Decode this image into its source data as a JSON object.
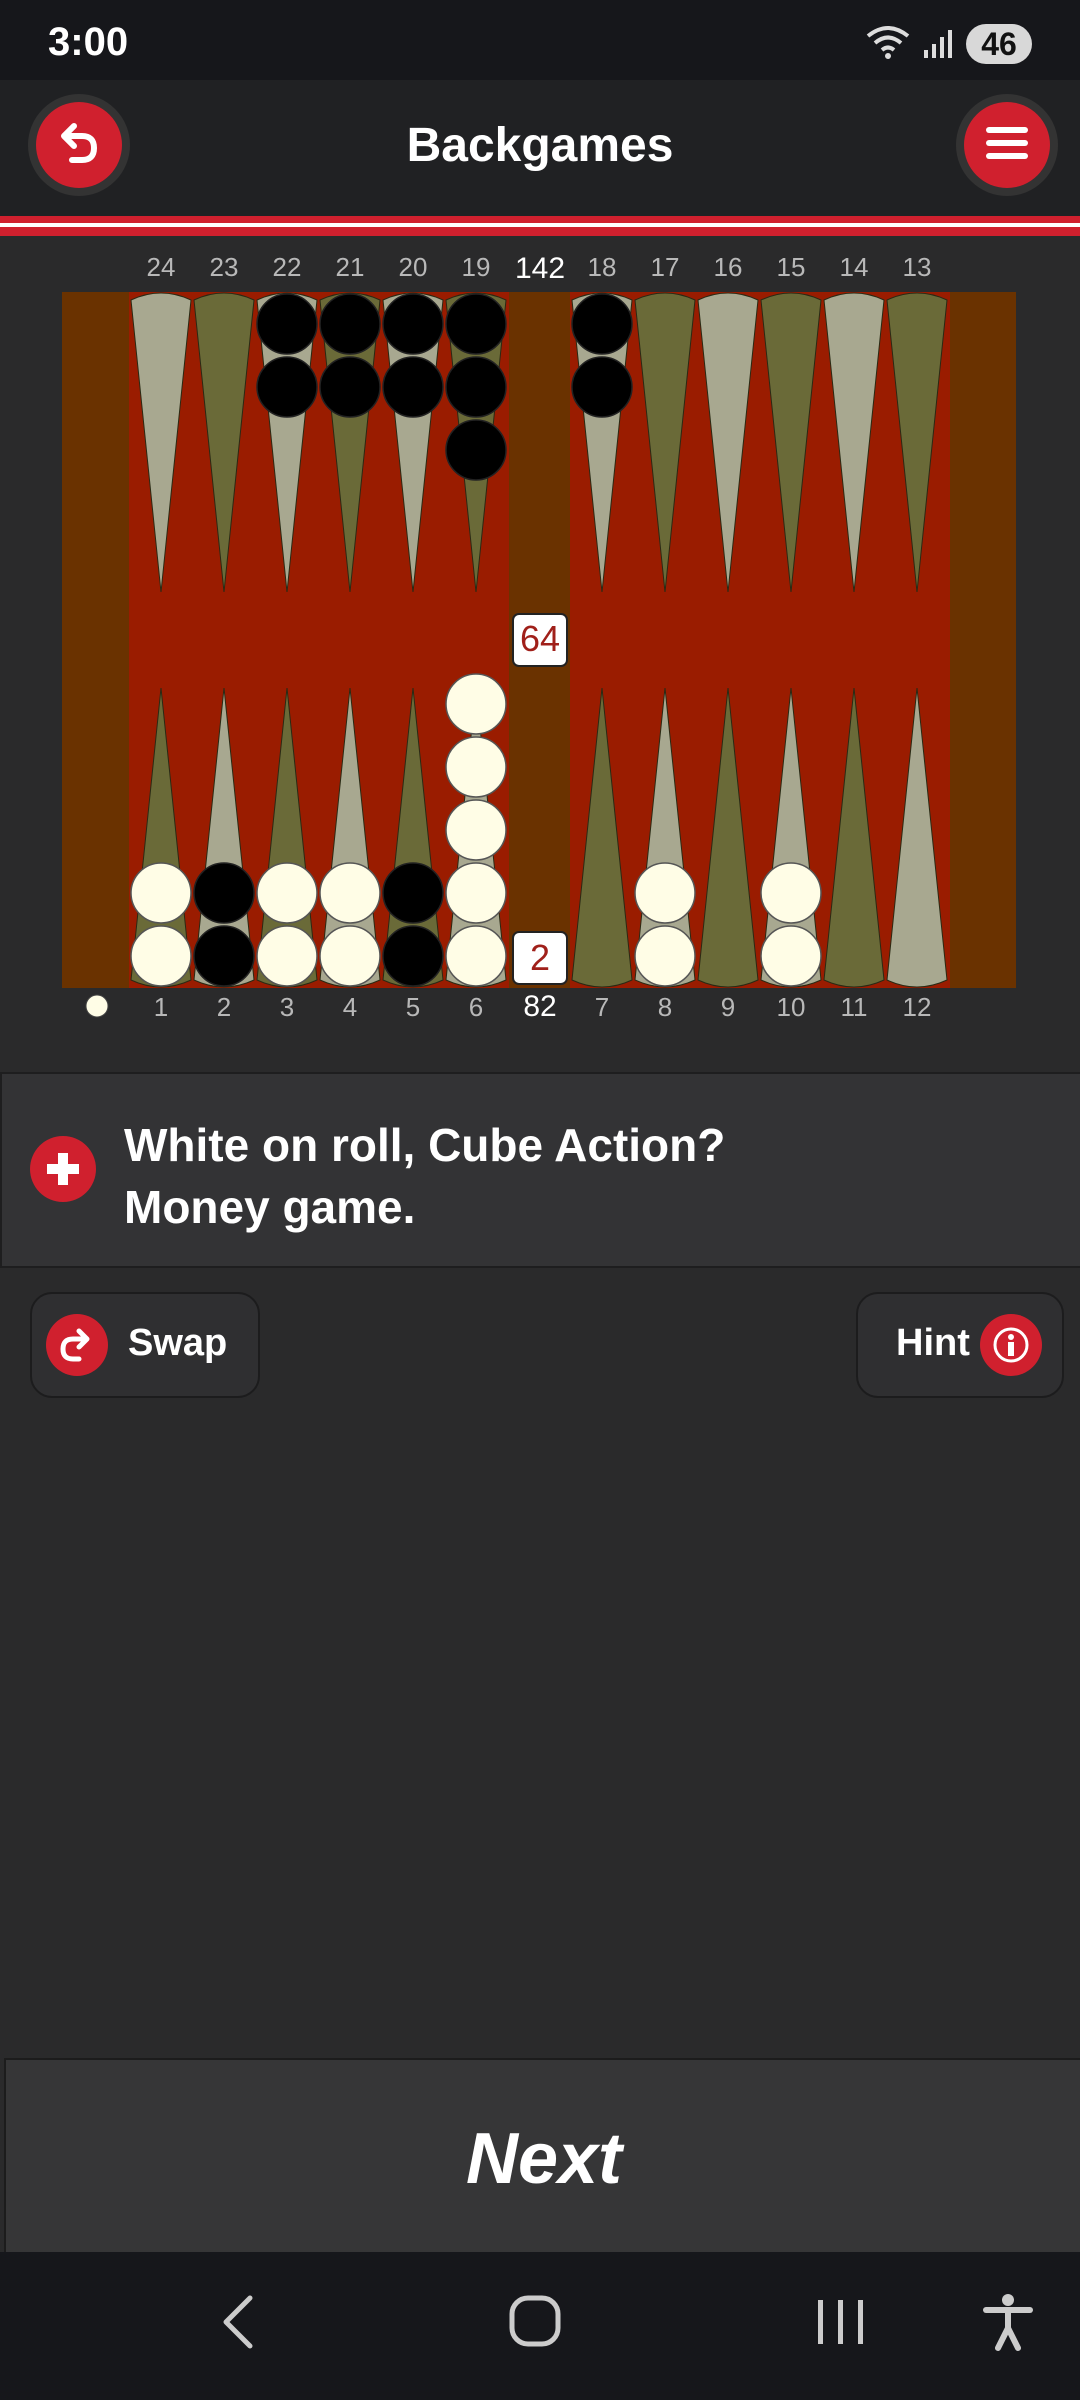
{
  "status": {
    "time": "3:00",
    "battery": "46",
    "wifi_icon": "wifi-icon",
    "signal_icon": "signal-icon"
  },
  "appbar": {
    "title": "Backgames",
    "back_icon": "undo-icon",
    "menu_icon": "hamburger-menu-icon"
  },
  "board": {
    "top_labels": [
      "24",
      "23",
      "22",
      "21",
      "20",
      "19",
      "18",
      "17",
      "16",
      "15",
      "14",
      "13"
    ],
    "bottom_labels": [
      "1",
      "2",
      "3",
      "4",
      "5",
      "6",
      "7",
      "8",
      "9",
      "10",
      "11",
      "12"
    ],
    "pip_top": "142",
    "pip_bottom": "82",
    "cube_top": "64",
    "cube_bottom": "2",
    "white_checkers": {
      "1": 2,
      "3": 2,
      "4": 2,
      "6": 5,
      "8": 2,
      "10": 2
    },
    "black_checkers": {
      "2": 2,
      "5": 2,
      "18": 2,
      "19": 3,
      "20": 2,
      "21": 2,
      "22": 2
    },
    "colors": {
      "frame": "#6a3200",
      "felt": "#9a1c00",
      "light_point": "#a8a890",
      "dark_point": "#6a6a38",
      "white_checker": "#fffde6",
      "black_checker": "#000000"
    }
  },
  "prompt": {
    "line1": "White on roll, Cube Action?",
    "line2": "Money game.",
    "icon": "plus-icon"
  },
  "buttons": {
    "swap": "Swap",
    "hint": "Hint",
    "swap_icon": "redo-icon",
    "hint_icon": "info-icon"
  },
  "next": {
    "label": "Next"
  },
  "navbar": {
    "back": "back-nav-icon",
    "home": "home-nav-icon",
    "recents": "recents-nav-icon",
    "accessibility": "accessibility-icon"
  }
}
